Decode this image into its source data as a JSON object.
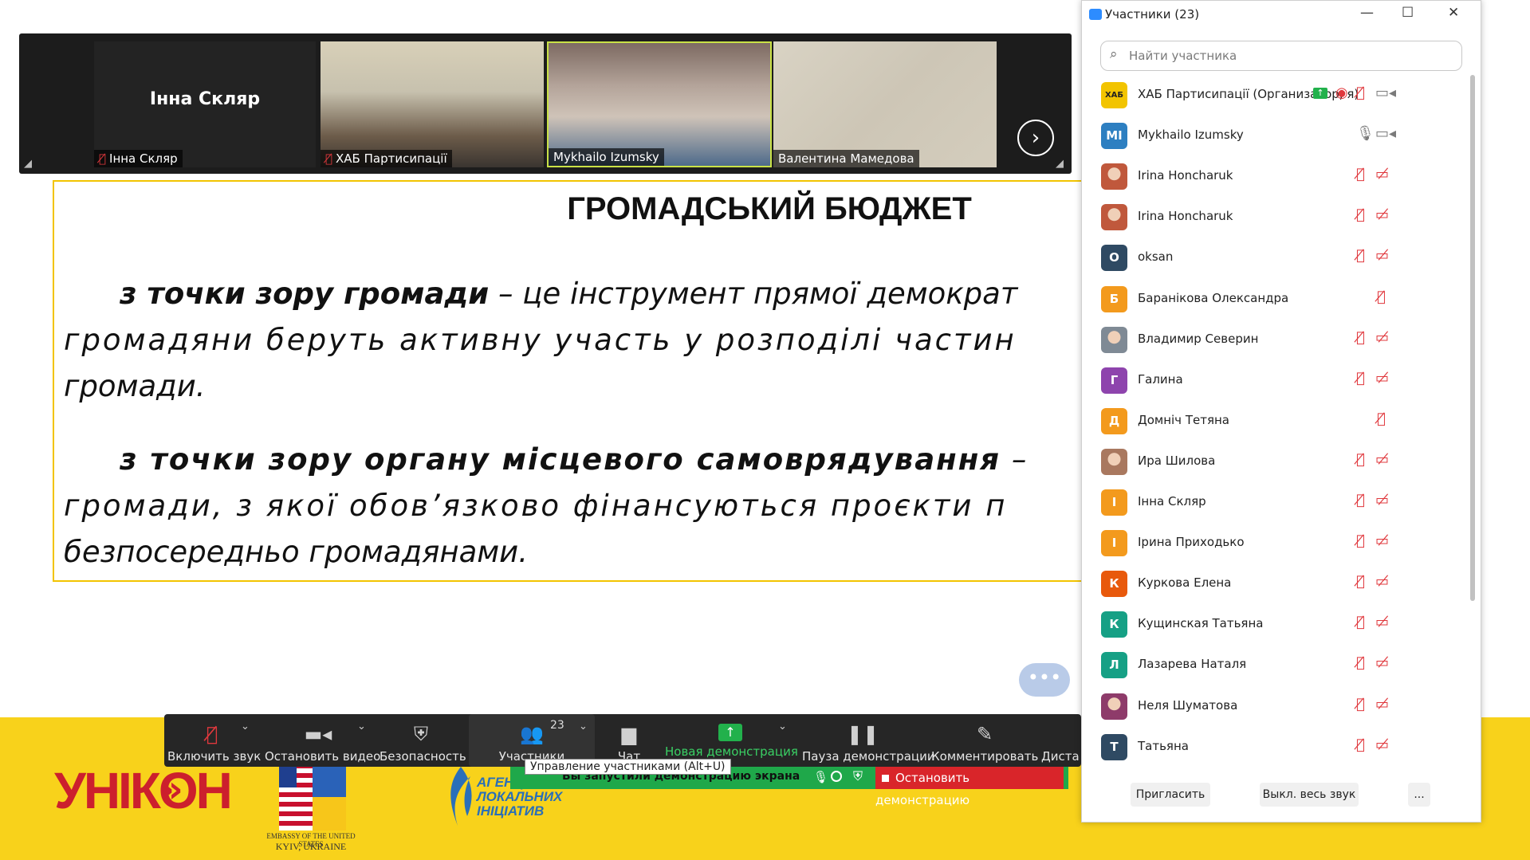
{
  "slide": {
    "title": "ГРОМАДСЬКИЙ БЮДЖЕТ",
    "p1_bold": "з точки зору громади",
    "p1_rest": " – це інструмент прямої демократ",
    "p1_line2": "громадяни беруть активну участь у розподілі частин",
    "p1_line3": "громади.",
    "p2_bold": "з точки зору органу місцевого самоврядування",
    "p2_rest": " – ",
    "p2_line2": "громади, з якої обов’язково фінансуються проєкти п",
    "p2_line3": "безпосередньо громадянами."
  },
  "logos": {
    "unikon": "УНІКОН",
    "unikon_arrow": "»",
    "embassy_line1": "EMBASSY OF THE UNITED STATES",
    "embassy_line2": "KYIV, UKRAINE",
    "ali_line1": "АГЕНЦІЯ",
    "ali_line2": "ЛОКАЛЬНИХ",
    "ali_line3": "ІНІЦІАТИВ"
  },
  "video_strip": {
    "tiles": [
      {
        "name": "Інна Скляр",
        "big_name": "Інна Скляр",
        "muted": true
      },
      {
        "name": "ХАБ Партисипації",
        "muted": true
      },
      {
        "name": "Mykhailo Izumsky",
        "muted": false
      },
      {
        "name": "Валентина Мамедова",
        "muted": false
      }
    ],
    "next": "›"
  },
  "toolbar": {
    "unmute": "Включить звук",
    "stop_video": "Остановить видео",
    "security": "Безопасность",
    "participants": "Участники",
    "participants_count": "23",
    "chat": "Чат",
    "new_share": "Новая демонстрация",
    "pause_share": "Пауза демонстрации",
    "annotate": "Комментировать",
    "remote": "Диста"
  },
  "share_bar": {
    "text": "Вы запустили демонстрацию экрана",
    "stop": "Остановить демонстрацию",
    "tooltip": "Управление участниками (Alt+U)"
  },
  "panel": {
    "title": "Участники (23)",
    "minimize": "—",
    "maximize": "☐",
    "close": "✕",
    "search_placeholder": "Найти участника",
    "participants": [
      {
        "name": "ХАБ Партисипації (Организатор, я)",
        "initials": "ХАБ",
        "color": "#f2c400"
      },
      {
        "name": "Mykhailo Izumsky",
        "initials": "MI",
        "color": "#2d7fc1"
      },
      {
        "name": "Irina Honcharuk",
        "initials": "",
        "color": "#c0583c"
      },
      {
        "name": "Irina Honcharuk",
        "initials": "",
        "color": "#c0583c"
      },
      {
        "name": "oksan",
        "initials": "O",
        "color": "#2f4a63"
      },
      {
        "name": "Баранікова Олександра",
        "initials": "Б",
        "color": "#f39a1d"
      },
      {
        "name": "Владимир Северин",
        "initials": "",
        "color": "#7f8a95"
      },
      {
        "name": "Галина",
        "initials": "Г",
        "color": "#8e44ad"
      },
      {
        "name": "Домніч Тетяна",
        "initials": "Д",
        "color": "#f39a1d"
      },
      {
        "name": "Ира Шилова",
        "initials": "",
        "color": "#a9785f"
      },
      {
        "name": "Інна Скляр",
        "initials": "І",
        "color": "#f39a1d"
      },
      {
        "name": "Ірина Приходько",
        "initials": "І",
        "color": "#f39a1d"
      },
      {
        "name": "Куркова Елена",
        "initials": "К",
        "color": "#e8590c"
      },
      {
        "name": "Кущинская Татьяна",
        "initials": "К",
        "color": "#16a085"
      },
      {
        "name": "Лазарева Наталя",
        "initials": "Л",
        "color": "#16a085"
      },
      {
        "name": "Неля Шуматова",
        "initials": "",
        "color": "#8e3b6a"
      },
      {
        "name": "Татьяна",
        "initials": "Т",
        "color": "#2f4a63"
      }
    ],
    "invite": "Пригласить",
    "mute_all": "Выкл. весь звук",
    "more": "..."
  },
  "colors": {
    "slide_yellow": "#f8d21b",
    "muted_red": "#e0383d",
    "share_green": "#1fa84a",
    "stop_red": "#d9252a",
    "zoom_blue": "#2d8cff"
  }
}
